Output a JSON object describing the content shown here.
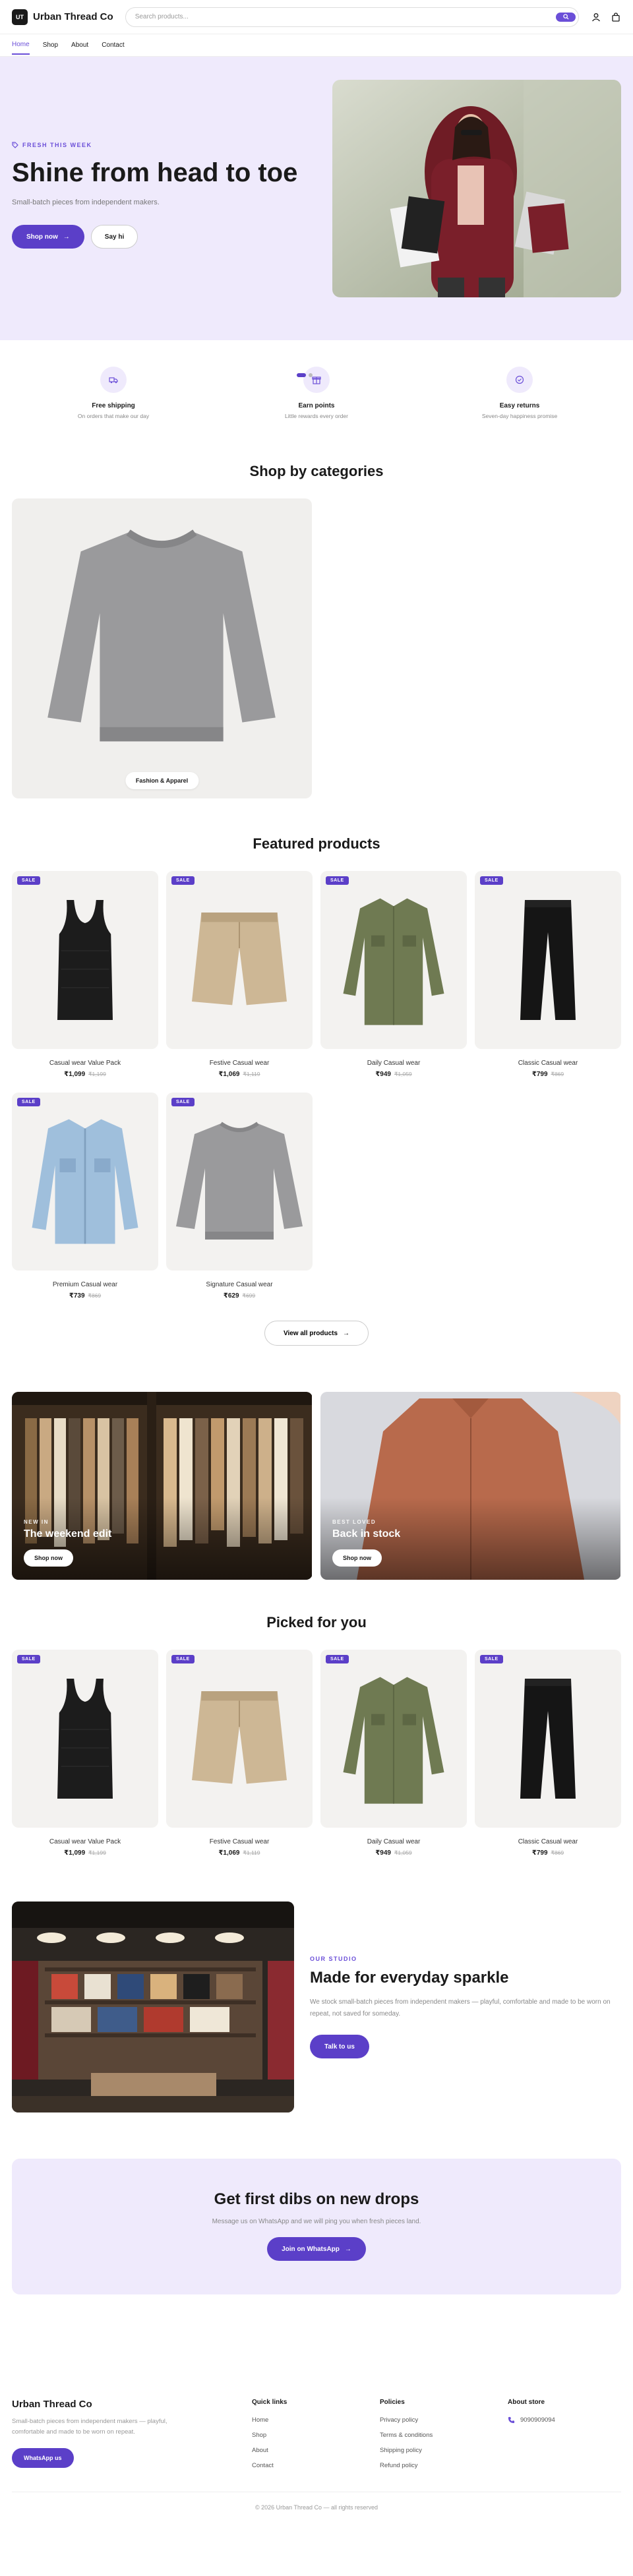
{
  "header": {
    "logo_text": "UT",
    "brand": "Urban Thread Co",
    "search_placeholder": "Search products...",
    "nav": [
      "Home",
      "Shop",
      "About",
      "Contact"
    ]
  },
  "hero": {
    "eyebrow": "FRESH THIS WEEK",
    "title": "Shine from head to toe",
    "subtitle": "Small-batch pieces from independent makers.",
    "primary_cta": "Shop now",
    "secondary_cta": "Say hi"
  },
  "features": [
    {
      "icon": "truck-icon",
      "title": "Free shipping",
      "subtitle": "On orders that make our day"
    },
    {
      "icon": "gift-icon",
      "title": "Earn points",
      "subtitle": "Little rewards every order"
    },
    {
      "icon": "check-circle-icon",
      "title": "Easy returns",
      "subtitle": "Seven-day happiness promise"
    }
  ],
  "categories": {
    "title": "Shop by categories",
    "items": [
      {
        "label": "Fashion & Apparel"
      }
    ]
  },
  "featured": {
    "title": "Featured products",
    "sale_label": "SALE",
    "products": [
      {
        "name": "Casual wear Value Pack",
        "price": "₹1,099",
        "old_price": "₹1,199",
        "type": "tank"
      },
      {
        "name": "Festive Casual wear",
        "price": "₹1,069",
        "old_price": "₹1,119",
        "type": "shorts"
      },
      {
        "name": "Daily Casual wear",
        "price": "₹949",
        "old_price": "₹1,059",
        "type": "shirt"
      },
      {
        "name": "Classic Casual wear",
        "price": "₹799",
        "old_price": "₹869",
        "type": "pants"
      },
      {
        "name": "Premium Casual wear",
        "price": "₹739",
        "old_price": "₹869",
        "type": "jacket"
      },
      {
        "name": "Signature Casual wear",
        "price": "₹629",
        "old_price": "₹699",
        "type": "sweater"
      }
    ],
    "view_all": "View all products"
  },
  "banners": [
    {
      "eyebrow": "NEW IN",
      "title": "The weekend edit",
      "cta": "Shop now"
    },
    {
      "eyebrow": "BEST LOVED",
      "title": "Back in stock",
      "cta": "Shop now"
    }
  ],
  "picked": {
    "title": "Picked for you",
    "products": [
      {
        "name": "Casual wear Value Pack",
        "price": "₹1,099",
        "old_price": "₹1,199",
        "type": "tank"
      },
      {
        "name": "Festive Casual wear",
        "price": "₹1,069",
        "old_price": "₹1,119",
        "type": "shorts"
      },
      {
        "name": "Daily Casual wear",
        "price": "₹949",
        "old_price": "₹1,059",
        "type": "shirt"
      },
      {
        "name": "Classic Casual wear",
        "price": "₹799",
        "old_price": "₹869",
        "type": "pants"
      }
    ]
  },
  "story": {
    "eyebrow": "OUR STUDIO",
    "title": "Made for everyday sparkle",
    "body": "We stock small-batch pieces from independent makers — playful, comfortable and made to be worn on repeat, not saved for someday.",
    "cta": "Talk to us"
  },
  "newsletter": {
    "title": "Get first dibs on new drops",
    "subtitle": "Message us on WhatsApp and we will ping you when fresh pieces land.",
    "cta": "Join on WhatsApp"
  },
  "footer": {
    "brand": "Urban Thread Co",
    "tagline": "Small-batch pieces from independent makers — playful, comfortable and made to be worn on repeat.",
    "whatsapp": "WhatsApp us",
    "quick_links_title": "Quick links",
    "quick_links": [
      "Home",
      "Shop",
      "About",
      "Contact"
    ],
    "policies_title": "Policies",
    "policies": [
      "Privacy policy",
      "Terms & conditions",
      "Shipping policy",
      "Refund policy"
    ],
    "about_title": "About store",
    "phone": "9090909094",
    "copyright": "© 2026 Urban Thread Co — all rights reserved"
  },
  "colors": {
    "accent": "#5b3fc8",
    "hero_bg": "#efeafc"
  }
}
